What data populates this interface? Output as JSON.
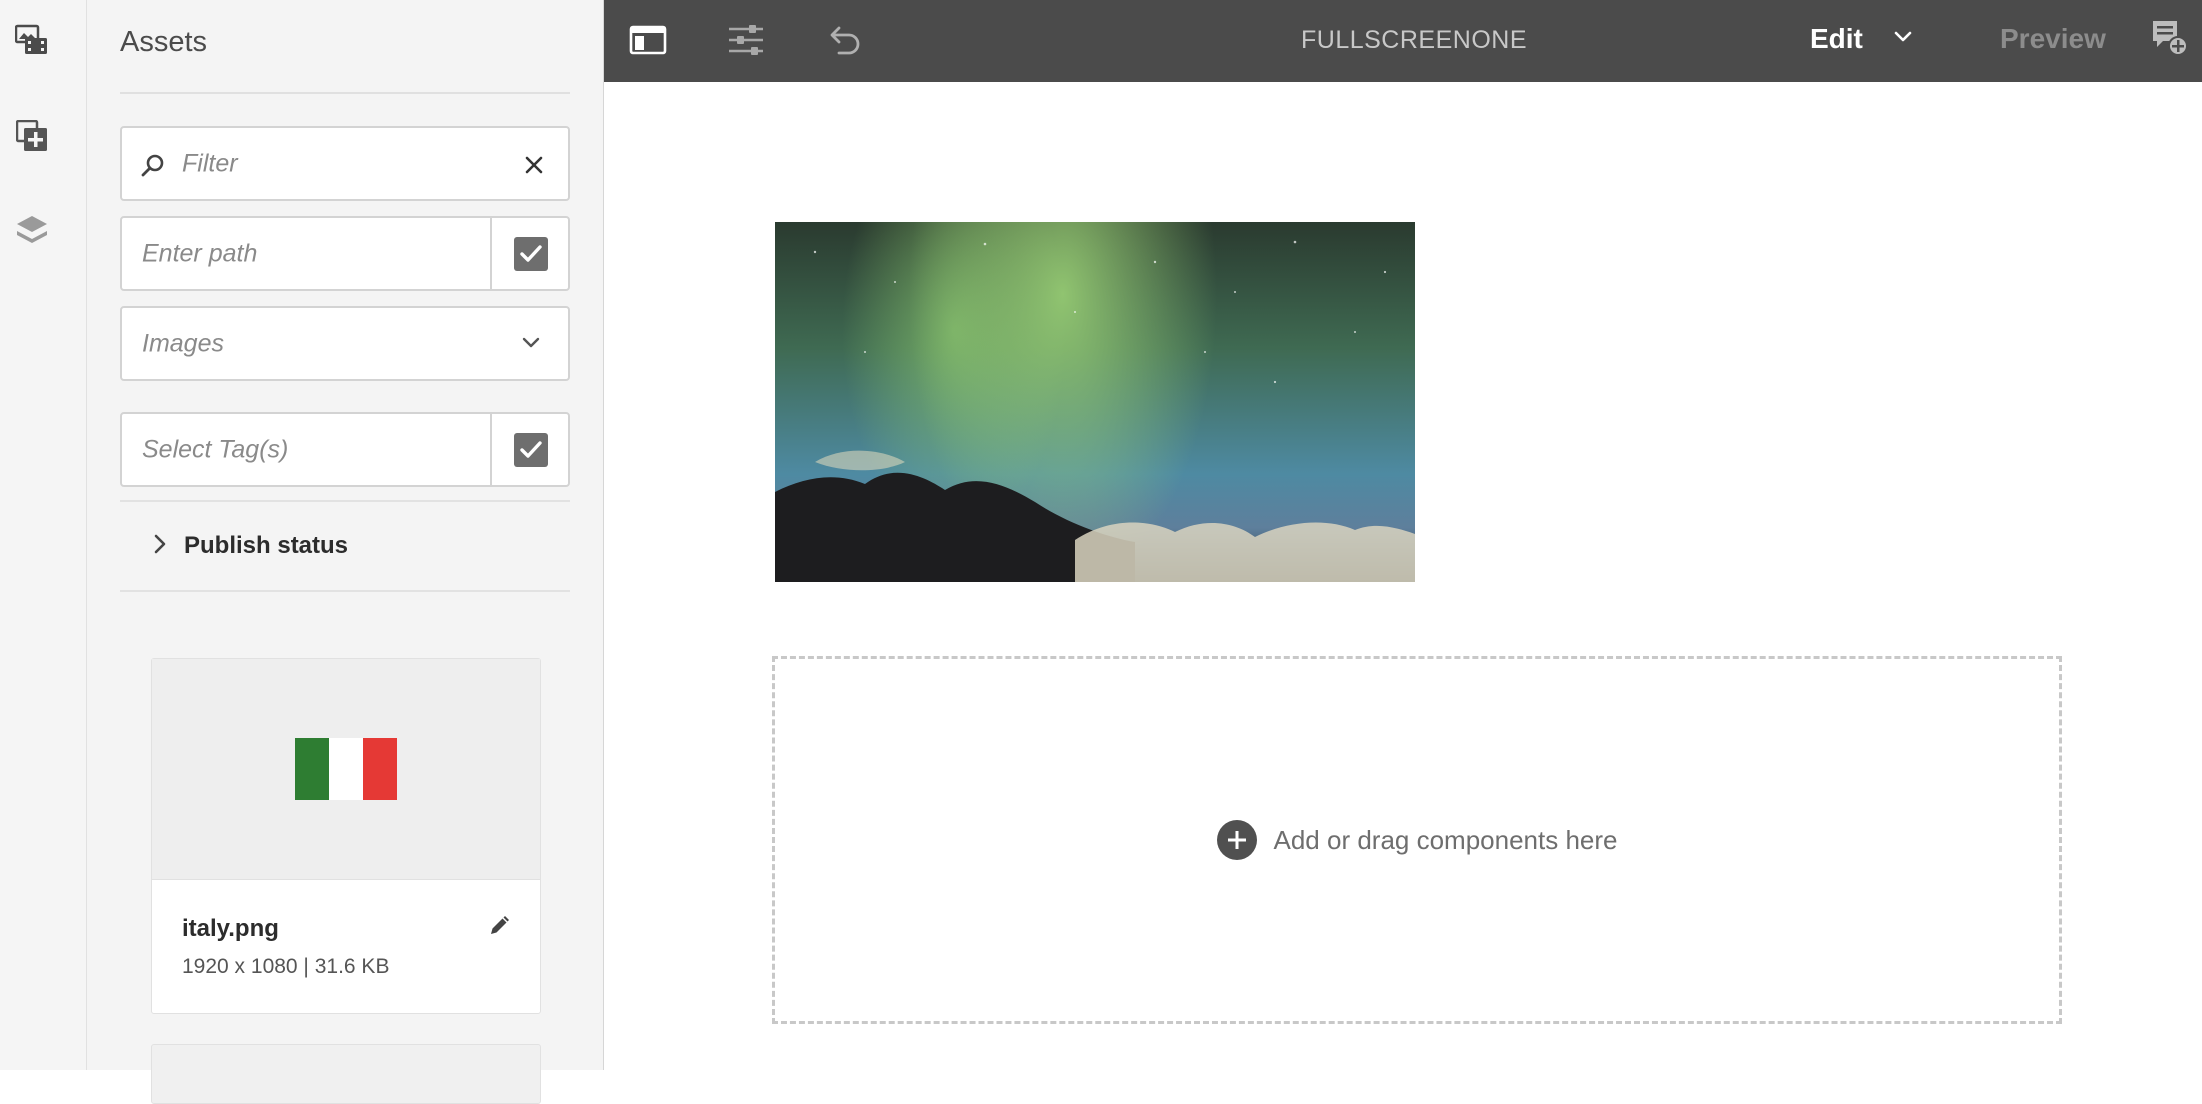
{
  "panel": {
    "title": "Assets",
    "filter": {
      "placeholder": "Filter"
    },
    "path": {
      "placeholder": "Enter path"
    },
    "type_select": {
      "value": "Images"
    },
    "tags": {
      "placeholder": "Select Tag(s)"
    },
    "publish_status": {
      "label": "Publish status"
    },
    "cards": [
      {
        "name": "italy.png",
        "meta": "1920 x 1080 | 31.6 KB"
      }
    ]
  },
  "toolbar": {
    "page_title": "FULLSCREENONE",
    "mode_label": "Edit",
    "preview_label": "Preview"
  },
  "canvas": {
    "drop_text": "Add or drag components here"
  },
  "colors": {
    "toolbar_bg": "#4b4b4b",
    "panel_bg": "#f4f4f4",
    "flag_green": "#2e7d32",
    "flag_white": "#ffffff",
    "flag_red": "#e53935"
  },
  "icons": {
    "rail": [
      "assets-icon",
      "components-icon",
      "layers-icon"
    ],
    "toolbar": [
      "side-panel-icon",
      "properties-icon",
      "undo-icon",
      "chevron-down-icon",
      "annotate-icon"
    ]
  }
}
